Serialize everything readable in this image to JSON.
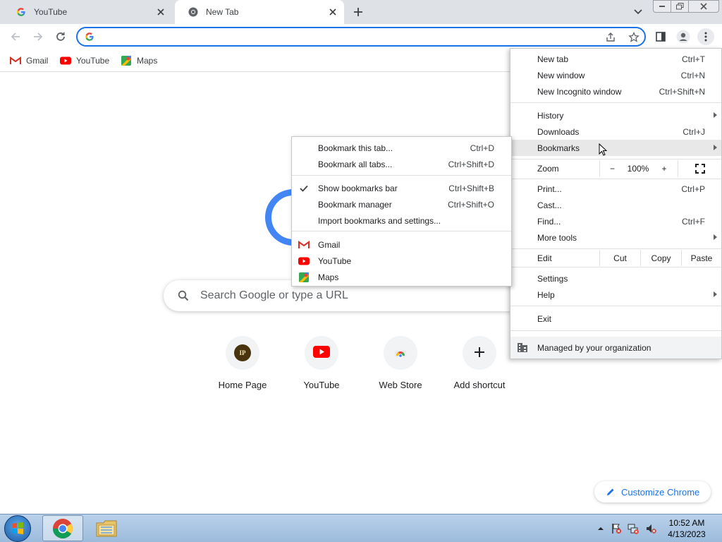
{
  "tabs": [
    {
      "title": "YouTube",
      "icon": "google-g-icon"
    },
    {
      "title": "New Tab",
      "icon": "chrome-icon"
    }
  ],
  "bookmarks_bar": [
    {
      "label": "Gmail",
      "icon": "gmail-icon"
    },
    {
      "label": "YouTube",
      "icon": "youtube-icon"
    },
    {
      "label": "Maps",
      "icon": "maps-icon"
    }
  ],
  "omnibox": {
    "value": ""
  },
  "ntp": {
    "search_placeholder": "Search Google or type a URL",
    "shortcuts": [
      {
        "label": "Home Page",
        "initials": "IP"
      },
      {
        "label": "YouTube"
      },
      {
        "label": "Web Store"
      },
      {
        "label": "Add shortcut"
      }
    ],
    "customize_label": "Customize Chrome"
  },
  "main_menu": {
    "new_tab": {
      "label": "New tab",
      "shortcut": "Ctrl+T"
    },
    "new_window": {
      "label": "New window",
      "shortcut": "Ctrl+N"
    },
    "new_incognito": {
      "label": "New Incognito window",
      "shortcut": "Ctrl+Shift+N"
    },
    "history": {
      "label": "History"
    },
    "downloads": {
      "label": "Downloads",
      "shortcut": "Ctrl+J"
    },
    "bookmarks": {
      "label": "Bookmarks"
    },
    "zoom": {
      "label": "Zoom",
      "minus": "−",
      "level": "100%",
      "plus": "+"
    },
    "print": {
      "label": "Print...",
      "shortcut": "Ctrl+P"
    },
    "cast": {
      "label": "Cast..."
    },
    "find": {
      "label": "Find...",
      "shortcut": "Ctrl+F"
    },
    "more_tools": {
      "label": "More tools"
    },
    "edit": {
      "label": "Edit",
      "cut": "Cut",
      "copy": "Copy",
      "paste": "Paste"
    },
    "settings": {
      "label": "Settings"
    },
    "help": {
      "label": "Help"
    },
    "exit": {
      "label": "Exit"
    },
    "managed": {
      "label": "Managed by your organization"
    }
  },
  "bookmarks_menu": {
    "bookmark_tab": {
      "label": "Bookmark this tab...",
      "shortcut": "Ctrl+D"
    },
    "bookmark_all": {
      "label": "Bookmark all tabs...",
      "shortcut": "Ctrl+Shift+D"
    },
    "show_bar": {
      "label": "Show bookmarks bar",
      "shortcut": "Ctrl+Shift+B",
      "checked": true
    },
    "manager": {
      "label": "Bookmark manager",
      "shortcut": "Ctrl+Shift+O"
    },
    "import": {
      "label": "Import bookmarks and settings..."
    },
    "items": [
      {
        "label": "Gmail",
        "icon": "gmail-icon"
      },
      {
        "label": "YouTube",
        "icon": "youtube-icon"
      },
      {
        "label": "Maps",
        "icon": "maps-icon"
      }
    ]
  },
  "taskbar": {
    "clock_time": "10:52 AM",
    "clock_date": "4/13/2023"
  },
  "colors": {
    "accent": "#1a73e8",
    "youtube_red": "#ff0000",
    "menu_highlight": "#e8e8e8"
  }
}
